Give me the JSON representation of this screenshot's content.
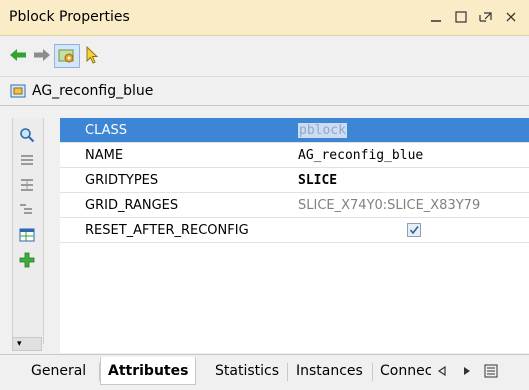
{
  "window": {
    "title": "Pblock Properties"
  },
  "object": {
    "name": "AG_reconfig_blue"
  },
  "properties": [
    {
      "key": "CLASS",
      "value": "pblock",
      "selected": true
    },
    {
      "key": "NAME",
      "value": "AG_reconfig_blue"
    },
    {
      "key": "GRIDTYPES",
      "value": "SLICE"
    },
    {
      "key": "GRID_RANGES",
      "value": "SLICE_X74Y0:SLICE_X83Y79"
    },
    {
      "key": "RESET_AFTER_RECONFIG",
      "value": "checked"
    }
  ],
  "tabs": [
    "General",
    "Attributes",
    "Statistics",
    "Instances",
    "Connectiv"
  ],
  "active_tab": "Attributes",
  "colors": {
    "titlebar": "#f9ecc6",
    "selection": "#3d86d6",
    "accent_green": "#2fa52f"
  }
}
